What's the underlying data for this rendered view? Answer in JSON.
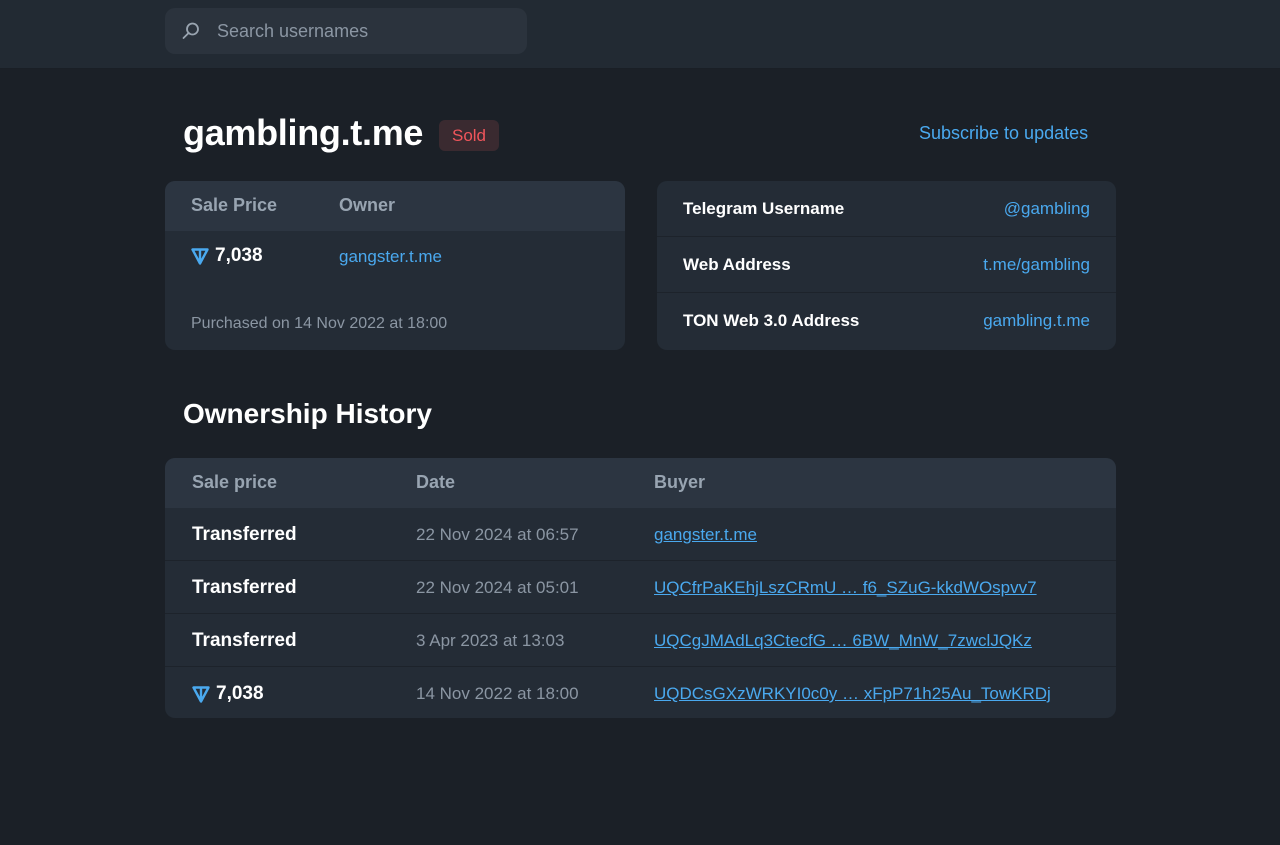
{
  "search": {
    "placeholder": "Search usernames"
  },
  "header": {
    "title": "gambling.t.me",
    "status": "Sold",
    "subscribe_label": "Subscribe to updates"
  },
  "sale": {
    "headers": {
      "price": "Sale Price",
      "owner": "Owner"
    },
    "price": "7,038",
    "currency_icon": "ton-icon",
    "owner": "gangster.t.me",
    "purchased": "Purchased on 14 Nov 2022 at 18:00"
  },
  "info": [
    {
      "label": "Telegram Username",
      "value": "@gambling"
    },
    {
      "label": "Web Address",
      "value": "t.me/gambling"
    },
    {
      "label": "TON Web 3.0 Address",
      "value": "gambling.t.me"
    }
  ],
  "history": {
    "title": "Ownership History",
    "columns": {
      "price": "Sale price",
      "date": "Date",
      "buyer": "Buyer"
    },
    "rows": [
      {
        "price": "Transferred",
        "date": "22 Nov 2024 at 06:57",
        "buyer": "gangster.t.me"
      },
      {
        "price": "Transferred",
        "date": "22 Nov 2024 at 05:01",
        "buyer": "UQCfrPaKEhjLszCRmU … f6_SZuG-kkdWOspvv7"
      },
      {
        "price": "Transferred",
        "date": "3 Apr 2023 at 13:03",
        "buyer": "UQCgJMAdLq3CtecfG … 6BW_MnW_7zwclJQKz"
      },
      {
        "price": "7,038",
        "date": "14 Nov 2022 at 18:00",
        "buyer": "UQDCsGXzWRKYI0c0y … xFpP71h25Au_TowKRDj"
      }
    ]
  },
  "colors": {
    "accent": "#4aa9ef",
    "sold": "#f0555b",
    "background": "#1b2027",
    "card": "#242c36"
  }
}
